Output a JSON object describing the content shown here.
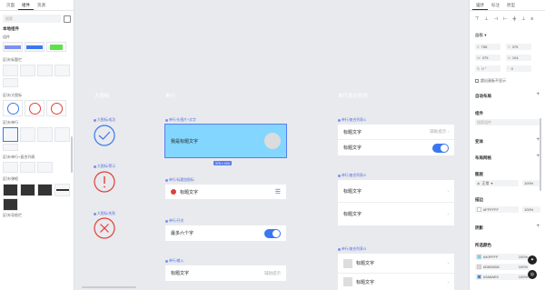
{
  "left": {
    "tabs": [
      "页面",
      "组件",
      "资源"
    ],
    "active_tab": 1,
    "search_placeholder": "搜索",
    "heading": "本地组件",
    "groups": [
      "组件",
      "区块/标题栏",
      "区块/大图标",
      "区块/单行",
      "区块/单行+复合列表",
      "区块/弹框",
      "区块/导航栏"
    ]
  },
  "canvas": {
    "col_titles": [
      "大图标",
      "单行",
      "单行复合列表"
    ],
    "icon_labels": [
      "大图标/成功",
      "大图标/警示",
      "大图标/失败"
    ],
    "row_labels": [
      "单行/头图片+文字",
      "单行/标题加图标",
      "单行/开关",
      "单行/输入"
    ],
    "banner_text": "我是标题文字",
    "selection_size": "375 × 104",
    "row_title": "标题文字",
    "row_hint": "辅助提示",
    "row_limit": "最多六个字",
    "list_labels": [
      "单行/复合列表/1",
      "单行/复合列表/2",
      "单行/复合列表/3"
    ],
    "list_items": [
      "标题文字",
      "标题文字",
      "标题文字",
      "标题文字",
      "标题文字",
      "标题文字",
      "标题文字"
    ],
    "list_hint": "辅助提示"
  },
  "right": {
    "tabs": [
      "设计",
      "标注",
      "原型"
    ],
    "active_tab": 0,
    "frame_label": "画板",
    "fields": {
      "x": "758",
      "y": "375",
      "w": "375",
      "h": "104",
      "r": "0 °",
      "rv": "0"
    },
    "clip_label": "超出画板不显示",
    "sections": [
      "自动布局",
      "组件",
      "变体",
      "布局网格",
      "图层",
      "描边",
      "描边",
      "外观",
      "阴影",
      "所选颜色"
    ],
    "component_search": "搜索组件",
    "layer_mode": "正常",
    "layer_opacity": "100%",
    "stroke_hex": "#FFFFFF",
    "stroke_opacity": "100%",
    "colors": [
      {
        "hex": "#40FFFF",
        "pct": "100%",
        "swatch": "#6fd3ff"
      },
      {
        "hex": "#D8D8D8",
        "pct": "100%",
        "swatch": "#d8d8d8"
      },
      {
        "hex": "#3A8AE0",
        "pct": "100%",
        "swatch": "#3a8ae0"
      }
    ]
  }
}
